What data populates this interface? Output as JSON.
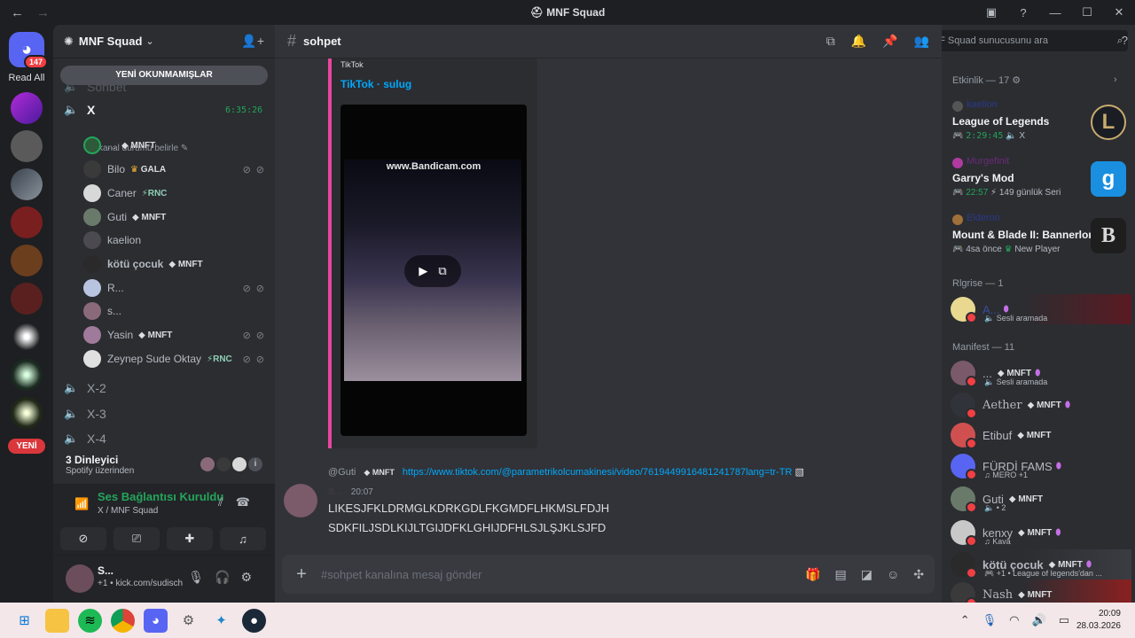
{
  "window": {
    "title": "MNF Squad",
    "back_arrow": "←",
    "forward_arrow": "→"
  },
  "rail": {
    "home_badge": "147",
    "read_all": "Read All",
    "new_pill": "YENİ"
  },
  "sidebar": {
    "server_name": "MNF Squad",
    "new_unread": "YENİ OKUNMAMIŞLAR",
    "faded_channel": "Sohbet",
    "active_voice": "X",
    "active_timer": "6:35:26",
    "status_hint": "Bir kanal durumu belirle",
    "voice_users": [
      {
        "name": "...",
        "tag": "MNFT"
      },
      {
        "name": "Bilo",
        "tag": "GALA"
      },
      {
        "name": "Caner",
        "tag": "RNC"
      },
      {
        "name": "Guti",
        "tag": "MNFT"
      },
      {
        "name": "kaelion",
        "tag": ""
      },
      {
        "name": "kötü çocuk",
        "tag": "MNFT"
      },
      {
        "name": "R...",
        "tag": ""
      },
      {
        "name": "s...",
        "tag": ""
      },
      {
        "name": "Yasin",
        "tag": "MNFT"
      },
      {
        "name": "Zeynep Sude Oktay",
        "tag": "RNC"
      }
    ],
    "other_voice": [
      "X-2",
      "X-3",
      "X-4"
    ],
    "listeners_title": "3 Dinleyici",
    "listeners_sub": "Spotify üzerinden",
    "voice_connected": "Ses Bağlantısı Kuruldu",
    "voice_location": "X / MNF Squad",
    "user_name": "S...",
    "user_status": "+1 • kick.com/sudisch"
  },
  "main": {
    "channel": "sohpet",
    "embed_provider": "TikTok",
    "embed_title": "TikTok · sulug",
    "video_watermark": "www.Bandicam.com",
    "reply_user": "@Guti",
    "reply_tag": "MNFT",
    "reply_link": "https://www.tiktok.com/@parametrikolcumakinesi/video/7619449916481241787lang=tr-TR",
    "msg_author": "S...",
    "msg_time": "20:07",
    "msg_line1": "LIKESJFKLDRMGLKDRKGDLFKGMDFLHKMSLFDJH",
    "msg_line2": "SDKFILJSDLKIJLTGIJDFKLGHIJDFHLSJLŞJKLSJFD",
    "composer_placeholder": "#sohpet kanalına mesaj gönder"
  },
  "right": {
    "search_placeholder": "MNF Squad sunucusunu ara",
    "activity_header": "Etkinlik — 17",
    "activities": [
      {
        "user": "kaelion",
        "game": "League of Legends",
        "time": "2:29:45",
        "extra": "X",
        "icon": "L"
      },
      {
        "user": "Murgefinit",
        "game": "Garry's Mod",
        "time": "22:57",
        "extra": "149 günlük Seri",
        "icon": "g"
      },
      {
        "user": "Elderon",
        "game": "Mount & Blade II: Bannerlord",
        "time": "4sa önce",
        "extra": "New Player",
        "icon": "B"
      }
    ],
    "group1_header": "Rlgrise — 1",
    "group1_member": {
      "name": "A...",
      "sub": "Sesli aramada"
    },
    "group2_header": "Manifest — 11",
    "members": [
      {
        "name": "...",
        "tag": "MNFT",
        "sub": "Sesli aramada"
      },
      {
        "name": "Aether",
        "tag": "MNFT",
        "sub": ""
      },
      {
        "name": "Etibuf",
        "tag": "MNFT",
        "sub": ""
      },
      {
        "name": "FÜRDİ FAMS",
        "tag": "",
        "sub": "MERO +1"
      },
      {
        "name": "Guti",
        "tag": "MNFT",
        "sub": "• 2"
      },
      {
        "name": "kenxy",
        "tag": "MNFT",
        "sub": "Kava"
      },
      {
        "name": "kötü çocuk",
        "tag": "MNFT",
        "sub": "+1 • League of legends'dan ..."
      },
      {
        "name": "Nash",
        "tag": "MNFT",
        "sub": ""
      }
    ]
  },
  "taskbar": {
    "time": "20:09",
    "date": "28.03.2026"
  }
}
